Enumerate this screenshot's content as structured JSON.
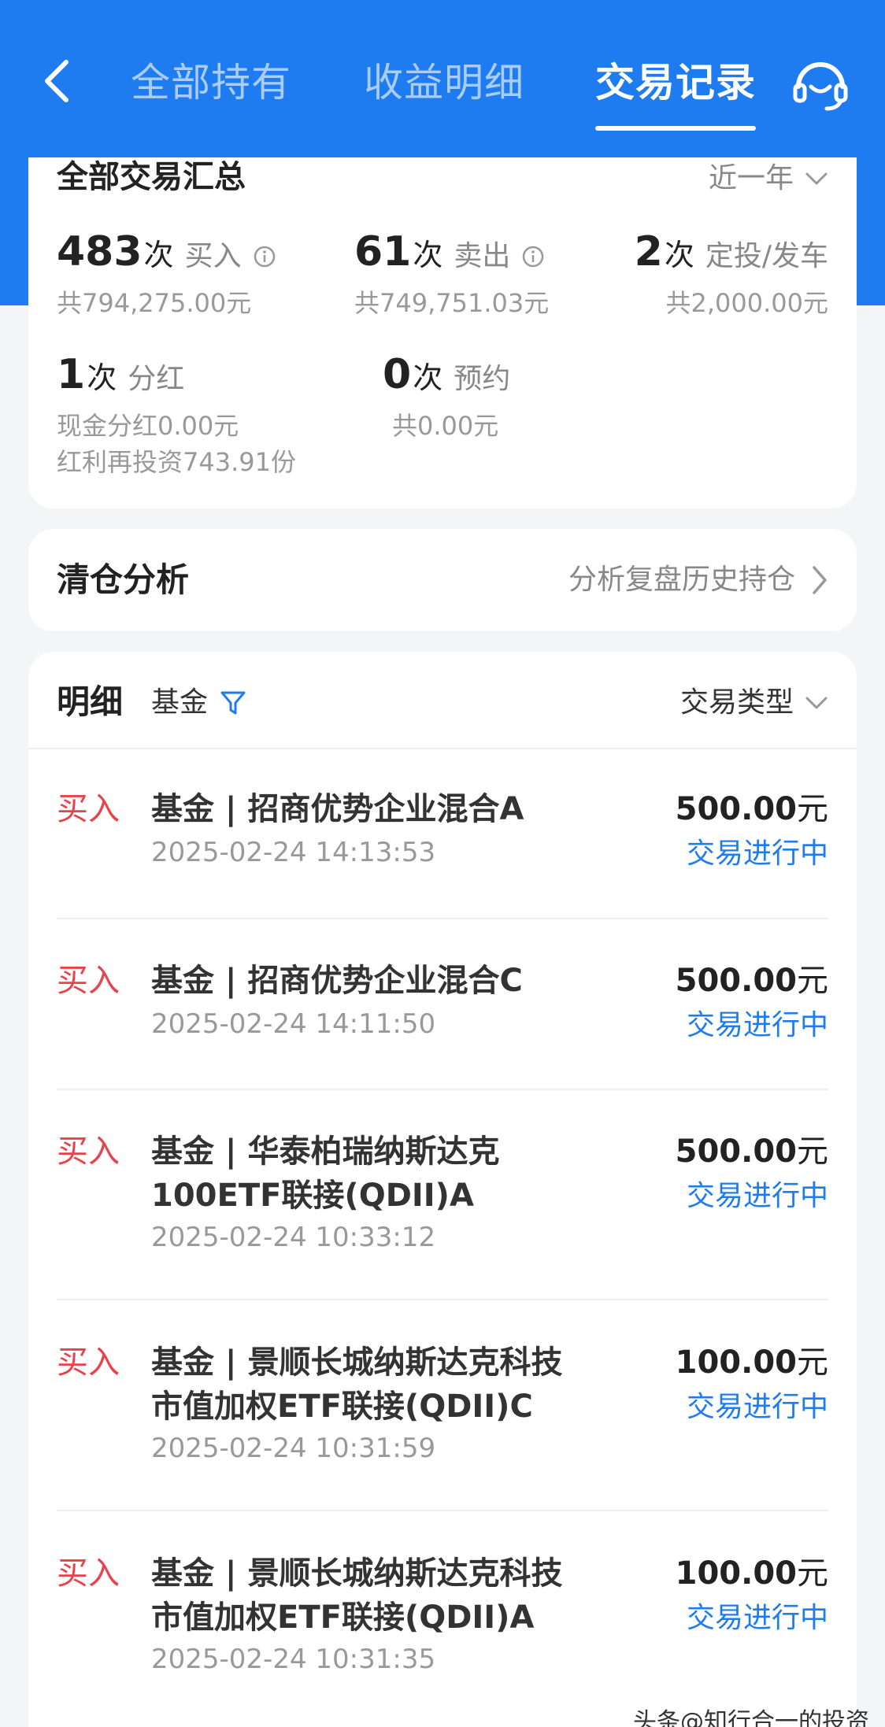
{
  "nav": {
    "tabs": [
      {
        "label": "全部持有",
        "active": false
      },
      {
        "label": "收益明细",
        "active": false
      },
      {
        "label": "交易记录",
        "active": true
      }
    ],
    "back_icon": "chevron-left-icon",
    "service_icon": "customer-service-headset-icon"
  },
  "summary": {
    "title": "全部交易汇总",
    "period": "近一年",
    "stats": [
      {
        "count": "483",
        "unit": "次",
        "label": "买入",
        "sub": [
          "共794,275.00元"
        ],
        "info": true
      },
      {
        "count": "61",
        "unit": "次",
        "label": "卖出",
        "sub": [
          "共749,751.03元"
        ],
        "info": true
      },
      {
        "count": "2",
        "unit": "次",
        "label": "定投/发车",
        "sub": [
          "共2,000.00元"
        ],
        "info": false
      },
      {
        "count": "1",
        "unit": "次",
        "label": "分红",
        "sub": [
          "现金分红0.00元",
          "红利再投资743.91份"
        ],
        "info": false
      },
      {
        "count": "0",
        "unit": "次",
        "label": "预约",
        "sub": [
          "共0.00元"
        ],
        "info": false
      }
    ]
  },
  "clearance": {
    "title": "清仓分析",
    "link": "分析复盘历史持仓"
  },
  "detail": {
    "title": "明细",
    "filter_fund": "基金",
    "filter_type": "交易类型",
    "transactions": [
      {
        "type": "买入",
        "name": "基金 | 招商优势企业混合A",
        "time": "2025-02-24 14:13:53",
        "amount": "500.00",
        "unit": "元",
        "status": "交易进行中"
      },
      {
        "type": "买入",
        "name": "基金 | 招商优势企业混合C",
        "time": "2025-02-24 14:11:50",
        "amount": "500.00",
        "unit": "元",
        "status": "交易进行中"
      },
      {
        "type": "买入",
        "name": "基金 | 华泰柏瑞纳斯达克100ETF联接(QDII)A",
        "time": "2025-02-24 10:33:12",
        "amount": "500.00",
        "unit": "元",
        "status": "交易进行中"
      },
      {
        "type": "买入",
        "name": "基金 | 景顺长城纳斯达克科技市值加权ETF联接(QDII)C",
        "time": "2025-02-24 10:31:59",
        "amount": "100.00",
        "unit": "元",
        "status": "交易进行中"
      },
      {
        "type": "买入",
        "name": "基金 | 景顺长城纳斯达克科技市值加权ETF联接(QDII)A",
        "time": "2025-02-24 10:31:35",
        "amount": "100.00",
        "unit": "元",
        "status": "交易进行中"
      }
    ]
  },
  "watermark": "头条@知行合一的投资",
  "colors": {
    "brand_blue": "#1f7cf0",
    "buy_red": "#e8424b",
    "status_blue": "#1f7cf0",
    "page_bg": "#f4f5f7"
  }
}
